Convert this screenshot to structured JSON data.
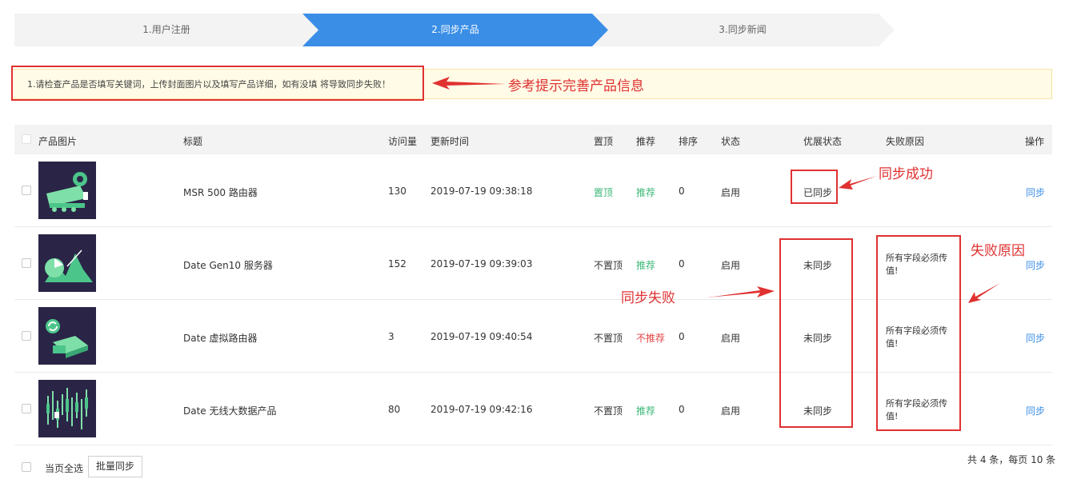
{
  "steps": [
    "1.用户注册",
    "2.同步产品",
    "3.同步新闻"
  ],
  "notice": {
    "text": "1.请检查产品是否填写关键词，上传封面图片以及填写产品详细，如有没填 将导致同步失败！"
  },
  "annotations": {
    "hint": "参考提示完善产品信息",
    "success": "同步成功",
    "fail": "同步失败",
    "fail_reason": "失败原因"
  },
  "table": {
    "headers": {
      "image": "产品图片",
      "title": "标题",
      "visits": "访问量",
      "updated": "更新时间",
      "top": "置顶",
      "recommend": "推荐",
      "sort": "排序",
      "status": "状态",
      "sync_status": "优展状态",
      "fail_reason": "失败原因",
      "action": "操作"
    },
    "rows": [
      {
        "title": "MSR 500 路由器",
        "visits": "130",
        "updated": "2019-07-19 09:38:18",
        "top": "置顶",
        "recommend": "推荐",
        "sort": "0",
        "status": "启用",
        "sync_status": "已同步",
        "reason": "",
        "action": "同步"
      },
      {
        "title": "Date Gen10 服务器",
        "visits": "152",
        "updated": "2019-07-19 09:39:03",
        "top": "不置顶",
        "recommend": "推荐",
        "sort": "0",
        "status": "启用",
        "sync_status": "未同步",
        "reason": "所有字段必须传值!",
        "action": "同步"
      },
      {
        "title": "Date 虚拟路由器",
        "visits": "3",
        "updated": "2019-07-19 09:40:54",
        "top": "不置顶",
        "recommend": "不推荐",
        "sort": "0",
        "status": "启用",
        "sync_status": "未同步",
        "reason": "所有字段必须传值!",
        "action": "同步"
      },
      {
        "title": "Date 无线大数据产品",
        "visits": "80",
        "updated": "2019-07-19 09:42:16",
        "top": "不置顶",
        "recommend": "推荐",
        "sort": "0",
        "status": "启用",
        "sync_status": "未同步",
        "reason": "所有字段必须传值!",
        "action": "同步"
      }
    ]
  },
  "footer": {
    "select_all": "当页全选",
    "batch_sync": "批量同步",
    "pagination": "共 4 条，每页 10 条"
  },
  "colors": {
    "accent": "#3a8ee6",
    "annotation": "#e03131",
    "positive": "#3cb878",
    "negative": "#e54545",
    "notice_bg": "#fffbe6"
  }
}
